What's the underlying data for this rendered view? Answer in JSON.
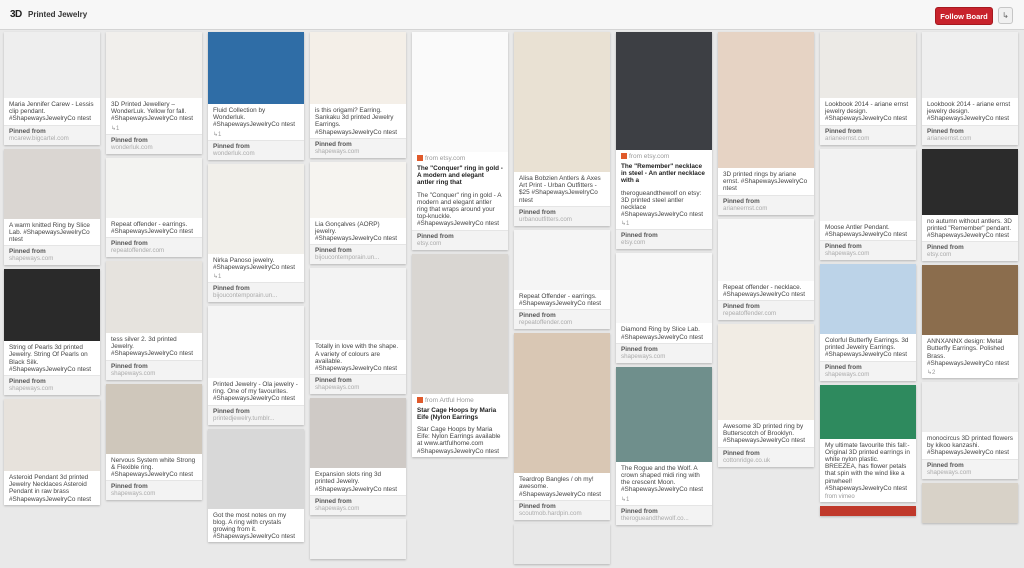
{
  "header": {
    "logo": "3D",
    "board_title": "Printed Jewelry",
    "follow_label": "Follow Board",
    "share_icon": "↳"
  },
  "columns": [
    [
      {
        "img_bg": "#eeeeee",
        "img_h": 66,
        "desc": "Maria Jennifer Carew - Lessis clip pendant. #ShapewaysJewelryCo ntest",
        "pinned_label": "Pinned from",
        "pinned_source": "mcarew.bigcartel.com"
      },
      {
        "img_bg": "#dad6d2",
        "img_h": 70,
        "desc": "A warm knitted Ring by Slice Lab. #ShapewaysJewelryCo ntest",
        "pinned_label": "Pinned from",
        "pinned_source": "shapeways.com"
      },
      {
        "img_bg": "#2a2a2a",
        "img_h": 72,
        "desc": "String of Pearls 3d printed Jewelry. String Of Pearls on Black Silk. #ShapewaysJewelryCo ntest",
        "pinned_label": "Pinned from",
        "pinned_source": "shapeways.com"
      },
      {
        "img_bg": "#e7e2dc",
        "img_h": 72,
        "desc": "Asteroid Pendant 3d printed Jewelry Necklaces Asteroid Pendant in raw brass #ShapewaysJewelryCo ntest"
      }
    ],
    [
      {
        "img_bg": "#f1efec",
        "img_h": 66,
        "desc": "3D Printed Jewellery – WonderLuk. Yellow for fall. #ShapewaysJewelryCo ntest",
        "repins": "↳1",
        "pinned_label": "Pinned from",
        "pinned_source": "wonderluk.com"
      },
      {
        "img_bg": "#f3f3f1",
        "img_h": 60,
        "desc": "Repeat offender - earrings. #ShapewaysJewelryCo ntest",
        "pinned_label": "Pinned from",
        "pinned_source": "repeatoffender.com"
      },
      {
        "img_bg": "#e6e3de",
        "img_h": 72,
        "desc": "tess silver 2. 3d printed Jewelry. #ShapewaysJewelryCo ntest",
        "pinned_label": "Pinned from",
        "pinned_source": "shapeways.com"
      },
      {
        "img_bg": "#cfc7bb",
        "img_h": 70,
        "desc": "Nervous System white Strong & Flexible ring. #ShapewaysJewelryCo ntest",
        "pinned_label": "Pinned from",
        "pinned_source": "shapeways.com"
      }
    ],
    [
      {
        "img_bg": "#2f6da6",
        "img_h": 72,
        "desc": "Fluid Collection by Wonderluk. #ShapewaysJewelryCo ntest",
        "repins": "↳1",
        "pinned_label": "Pinned from",
        "pinned_source": "wonderluk.com"
      },
      {
        "img_bg": "#f1efea",
        "img_h": 90,
        "desc": "Nirka Panoso jewelry. #ShapewaysJewelryCo ntest",
        "repins": "↳1",
        "pinned_label": "Pinned from",
        "pinned_source": "bijoucontemporain.un..."
      },
      {
        "img_bg": "#f4f4f4",
        "img_h": 72,
        "desc": "Printed Jewelry - Ola jewelry - ring. One of my favourites. #ShapewaysJewelryCo ntest",
        "pinned_label": "Pinned from",
        "pinned_source": "printedjewelry.tumblr..."
      },
      {
        "img_bg": "#d8d8d8",
        "img_h": 80,
        "desc": "Got the most notes on my blog. A ring with crystals growing from it. #ShapewaysJewelryCo ntest"
      }
    ],
    [
      {
        "img_bg": "#f4efe8",
        "img_h": 72,
        "desc": "is this origami? Earring. Sankaku 3d printed Jewelry Earrings. #ShapewaysJewelryCo ntest",
        "pinned_label": "Pinned from",
        "pinned_source": "shapeways.com"
      },
      {
        "img_bg": "#f6f4f0",
        "img_h": 56,
        "desc": "Lia Gonçalves (AORP) jewelry. #ShapewaysJewelryCo ntest",
        "pinned_label": "Pinned from",
        "pinned_source": "bijoucontemporain.un..."
      },
      {
        "img_bg": "#f3f3f3",
        "img_h": 72,
        "desc": "Totally in love with the shape. A variety of colours are available. #ShapewaysJewelryCo ntest",
        "pinned_label": "Pinned from",
        "pinned_source": "shapeways.com"
      },
      {
        "img_bg": "#cfcac6",
        "img_h": 70,
        "desc": "Expansion slots ring 3d printed Jewelry. #ShapewaysJewelryCo ntest",
        "pinned_label": "Pinned from",
        "pinned_source": "shapeways.com"
      },
      {
        "img_bg": "#f0f0f0",
        "img_h": 40
      }
    ],
    [
      {
        "img_bg": "#fafafa",
        "img_h": 120,
        "src_text": "from etsy.com",
        "desc_bold": "The \"Conquer\" ring in gold - A modern and elegant antler ring that",
        "desc": "The \"Conquer\" ring in gold - A modern and elegant antler ring that wraps around your top-knuckle. #ShapewaysJewelryCo ntest",
        "pinned_label": "Pinned from",
        "pinned_source": "etsy.com"
      },
      {
        "img_bg": "#d9d6d2",
        "img_h": 140,
        "src_text": "from Artful Home",
        "desc_bold": "Star Cage Hoops by Maria Eife (Nylon Earrings",
        "desc": "Star Cage Hoops by Maria Eife: Nylon Earrings available at www.artfulhome.com #ShapewaysJewelryCo ntest"
      }
    ],
    [
      {
        "img_bg": "#e9e1d3",
        "img_h": 140,
        "desc": "Alisa Bobzien Antlers & Axes Art Print - Urban Outfitters - $25 #ShapewaysJewelryCo ntest",
        "pinned_label": "Pinned from",
        "pinned_source": "urbanoutfitters.com"
      },
      {
        "img_bg": "#f5f5f5",
        "img_h": 60,
        "desc": "Repeat Offender - earrings. #ShapewaysJewelryCo ntest",
        "pinned_label": "Pinned from",
        "pinned_source": "repeatoffender.com"
      },
      {
        "img_bg": "#d9c7b4",
        "img_h": 140,
        "desc": "Teardrop Bangles / oh my! awesome. #ShapewaysJewelryCo ntest",
        "pinned_label": "Pinned from",
        "pinned_source": "scoutmob.hardpin.com"
      },
      {
        "img_bg": "#e8e8e8",
        "img_h": 40
      }
    ],
    [
      {
        "img_bg": "#3d3f44",
        "img_h": 118,
        "src_text": "from etsy.com",
        "desc_bold": "The \"Remember\" necklace in steel - An antler necklace with a",
        "desc": "therogueandthewolf on etsy: 3D printed steel antler necklace #ShapewaysJewelryCo ntest",
        "repins": "↳1",
        "pinned_label": "Pinned from",
        "pinned_source": "etsy.com"
      },
      {
        "img_bg": "#f7f7f7",
        "img_h": 70,
        "desc": "Diamond Ring by Slice Lab. #ShapewaysJewelryCo ntest",
        "pinned_label": "Pinned from",
        "pinned_source": "shapeways.com"
      },
      {
        "img_bg": "#6f8f8c",
        "img_h": 95,
        "desc": "The Rogue and the Wolf. A crown shaped midi ring with the crescent Moon. #ShapewaysJewelryCo ntest",
        "repins": "↳1",
        "pinned_label": "Pinned from",
        "pinned_source": "therogueandthewolf.co..."
      }
    ],
    [
      {
        "img_bg": "#e6d3c4",
        "img_h": 136,
        "desc": "3D printed rings by ariane ernst. #ShapewaysJewelryCo ntest",
        "pinned_label": "Pinned from",
        "pinned_source": "arianeernst.com"
      },
      {
        "img_bg": "#f7f7f7",
        "img_h": 62,
        "desc": "Repeat offender - necklace. #ShapewaysJewelryCo ntest",
        "pinned_label": "Pinned from",
        "pinned_source": "repeatoffender.com"
      },
      {
        "img_bg": "#f1ece4",
        "img_h": 96,
        "desc": "Awesome 3D printed ring by Butterscotch of Brooklyn. #ShapewaysJewelryCo ntest",
        "pinned_label": "Pinned from",
        "pinned_source": "cottonridge.co.uk"
      }
    ],
    [
      {
        "img_bg": "#eceae6",
        "img_h": 66,
        "desc": "Lookbook 2014 - ariane ernst jewelry design. #ShapewaysJewelryCo ntest",
        "pinned_label": "Pinned from",
        "pinned_source": "arianeernst.com"
      },
      {
        "img_bg": "#f2f2f2",
        "img_h": 72,
        "desc": "Moose Antler Pendant. #ShapewaysJewelryCo ntest",
        "pinned_label": "Pinned from",
        "pinned_source": "shapeways.com"
      },
      {
        "img_bg": "#bcd3e8",
        "img_h": 70,
        "desc": "Colorful Butterfly Earrings. 3d printed Jewelry Earrings. #ShapewaysJewelryCo ntest",
        "pinned_label": "Pinned from",
        "pinned_source": "shapeways.com"
      },
      {
        "img_bg": "#2e8a5e",
        "img_h": 54,
        "desc": "My ultimate favourite this fall:- Original 3D printed earrings in white nylon plastic. BREEZEA, has flower petals that spin with the wind like a pinwheel! #ShapewaysJewelryCo ntest",
        "video_source": "from vimeo"
      },
      {
        "img_bg": "#c0392b",
        "img_h": 10
      }
    ],
    [
      {
        "img_bg": "#efefef",
        "img_h": 66,
        "desc": "Lookbook 2014 - ariane ernst jewelry design. #ShapewaysJewelryCo ntest",
        "pinned_label": "Pinned from",
        "pinned_source": "arianeernst.com"
      },
      {
        "img_bg": "#2b2b2b",
        "img_h": 66,
        "desc": "no autumn without antlers. 3D printed \"Remember\" pendant. #ShapewaysJewelryCo ntest",
        "pinned_label": "Pinned from",
        "pinned_source": "etsy.com"
      },
      {
        "img_bg": "#8b6d4d",
        "img_h": 70,
        "desc": "ANNXANNX design: Metal Butterfly Earrings. Polished Brass. #ShapewaysJewelryCo ntest",
        "repins": "↳2"
      },
      {
        "img_bg": "#ededed",
        "img_h": 50,
        "desc": "monocircus 3D printed flowers by kikoo kanzashi. #ShapewaysJewelryCo ntest",
        "pinned_label": "Pinned from",
        "pinned_source": "shapeways.com"
      },
      {
        "img_bg": "#d8d2c8",
        "img_h": 40
      }
    ]
  ]
}
